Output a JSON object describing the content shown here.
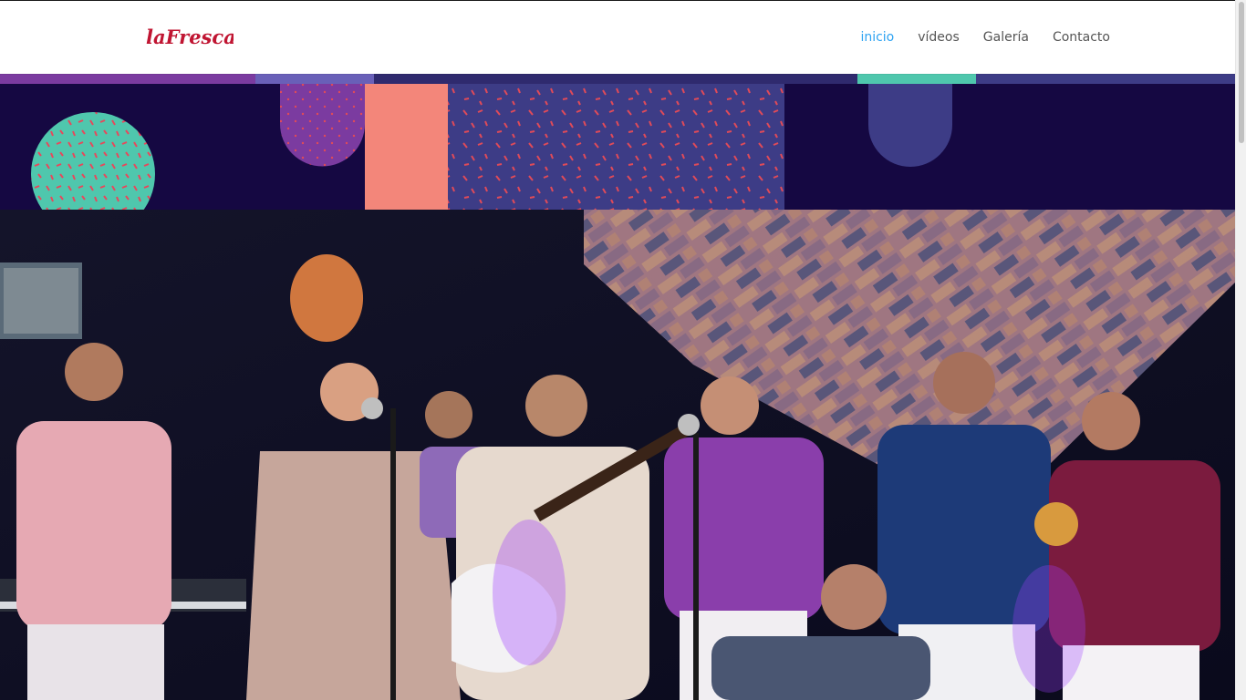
{
  "header": {
    "logo_text": "laFresca",
    "nav": [
      {
        "label": "inicio",
        "active": true
      },
      {
        "label": "vídeos",
        "active": false
      },
      {
        "label": "Galería",
        "active": false
      },
      {
        "label": "Contacto",
        "active": false
      }
    ]
  },
  "colors": {
    "brand_red": "#c01532",
    "active_link": "#2ea3f2",
    "banner_bg": "#150842",
    "teal": "#4fc7ad",
    "salmon": "#f3867a",
    "purple": "#7b3ba0",
    "indigo": "#3d3c86"
  },
  "hero": {
    "band_photo": "group photo of band members on stage with microphones, guitar and keyboard"
  }
}
